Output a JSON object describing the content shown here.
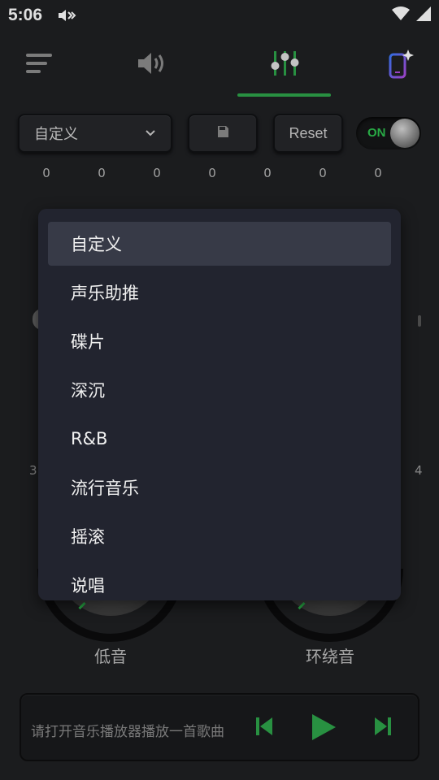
{
  "status_bar": {
    "time": "5:06"
  },
  "preset": {
    "selected": "自定义"
  },
  "reset_label": "Reset",
  "toggle_label": "ON",
  "band_values": [
    "0",
    "0",
    "0",
    "0",
    "0",
    "0",
    "0"
  ],
  "background": {
    "left_edge_text": "3",
    "right_edge_text": "4"
  },
  "knobs": {
    "bass_label": "低音",
    "surround_label": "环绕音"
  },
  "player": {
    "hint": "请打开音乐播放器播放一首歌曲"
  },
  "dropdown": {
    "options": [
      "自定义",
      "声乐助推",
      "碟片",
      "深沉",
      "R&B",
      "流行音乐",
      "摇滚",
      "说唱"
    ]
  },
  "colors": {
    "accent": "#2ea44a",
    "background": "#1f2023",
    "menu_bg": "#22242f",
    "selected_bg": "#373a47"
  },
  "icons": {
    "toolbar": [
      "menu-icon",
      "volume-icon",
      "equalizer-icon",
      "phone-sparkle-icon"
    ],
    "player": [
      "skip-previous-icon",
      "play-icon",
      "skip-next-icon"
    ]
  }
}
